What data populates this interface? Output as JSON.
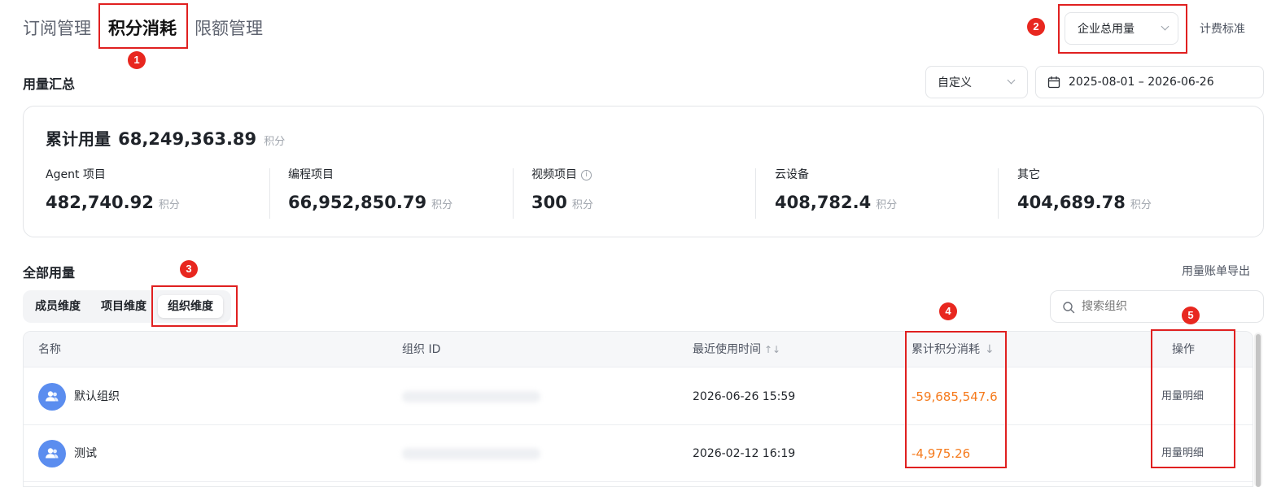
{
  "tabs": [
    {
      "label": "订阅管理",
      "active": false
    },
    {
      "label": "积分消耗",
      "active": true
    },
    {
      "label": "限额管理",
      "active": false
    }
  ],
  "header": {
    "scope_select": "企业总用量",
    "billing_link": "计费标准"
  },
  "summary": {
    "title": "用量汇总",
    "range_select": "自定义",
    "date_range": "2025-08-01 – 2026-06-26",
    "total_label": "累计用量",
    "total_value": "68,249,363.89",
    "unit": "积分",
    "stats": [
      {
        "label": "Agent 项目",
        "value": "482,740.92",
        "unit": "积分"
      },
      {
        "label": "编程项目",
        "value": "66,952,850.79",
        "unit": "积分"
      },
      {
        "label": "视频项目",
        "value": "300",
        "unit": "积分",
        "info_icon": "info-icon"
      },
      {
        "label": "云设备",
        "value": "408,782.4",
        "unit": "积分"
      },
      {
        "label": "其它",
        "value": "404,689.78",
        "unit": "积分"
      }
    ]
  },
  "usage": {
    "title": "全部用量",
    "export_link": "用量账单导出",
    "dimensions": [
      {
        "label": "成员维度",
        "active": false
      },
      {
        "label": "项目维度",
        "active": false
      },
      {
        "label": "组织维度",
        "active": true
      }
    ],
    "search_placeholder": "搜索组织"
  },
  "table": {
    "columns": [
      "名称",
      "组织 ID",
      "最近使用时间",
      "累计积分消耗",
      "操作"
    ],
    "rows": [
      {
        "name": "默认组织",
        "last_used": "2026-06-26 15:59",
        "points": "-59,685,547.6",
        "action": "用量明细"
      },
      {
        "name": "测试",
        "last_used": "2026-02-12 16:19",
        "points": "-4,975.26",
        "action": "用量明细"
      }
    ]
  },
  "markers": [
    "1",
    "2",
    "3",
    "4",
    "5"
  ],
  "colors": {
    "accent_orange": "#f57a1c",
    "annotation_red": "#e02020",
    "avatar_blue": "#5b8def"
  }
}
